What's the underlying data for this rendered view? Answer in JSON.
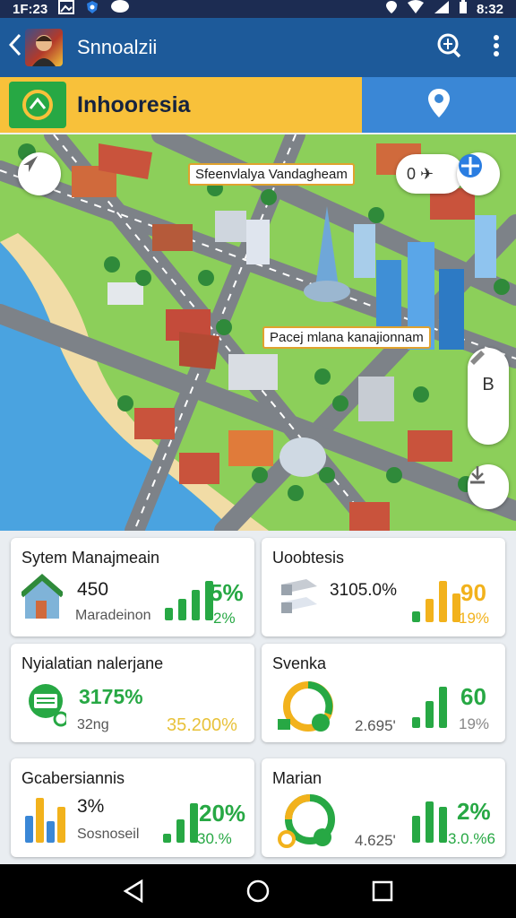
{
  "status_bar": {
    "time_left": "1F:23",
    "time_right": "8:32"
  },
  "app_bar": {
    "title": "Snnoalzii"
  },
  "banner": {
    "name": "Inhooresia"
  },
  "map": {
    "label_top": "Sfeenvlalya Vandagheam",
    "label_mid": "Pacej mlana kanajionnam",
    "control_label": "B",
    "search_pill_text": "0 ✈"
  },
  "cards": [
    {
      "title": "Sytem Manajmeain",
      "value": "450",
      "sub": "Maradeinon",
      "big": "5%",
      "small": "2%",
      "big_color": "#27a844",
      "small_color": "#27a844"
    },
    {
      "title": "Uoobtesis",
      "value": "3105.0%",
      "sub": "",
      "big": "90",
      "small": "19%",
      "big_color": "#f2b21c",
      "small_color": "#f2b21c"
    },
    {
      "title": "Nyialatian nalerjane",
      "value": "3175%",
      "sub": "32ng",
      "big": "",
      "small": "35.200%",
      "big_color": "#27a844",
      "small_color": "#e8c23a"
    },
    {
      "title": "Svenka",
      "value": "2.695'",
      "sub": "",
      "big": "60",
      "small": "19%",
      "big_color": "#27a844",
      "small_color": "#888888"
    },
    {
      "title": "Gcabersiannis",
      "value": "3%",
      "sub": "Sosnoseil",
      "big": "20%",
      "small": "30.%",
      "big_color": "#27a844",
      "small_color": "#27a844"
    },
    {
      "title": "Marian",
      "value": "4.625'",
      "sub": "",
      "big": "2%",
      "small": "3.0.%6",
      "big_color": "#27a844",
      "small_color": "#27a844"
    }
  ],
  "icons": {
    "back": "back-arrow-icon",
    "search": "search-icon",
    "more": "more-vert-icon",
    "location": "location-pin-icon"
  }
}
